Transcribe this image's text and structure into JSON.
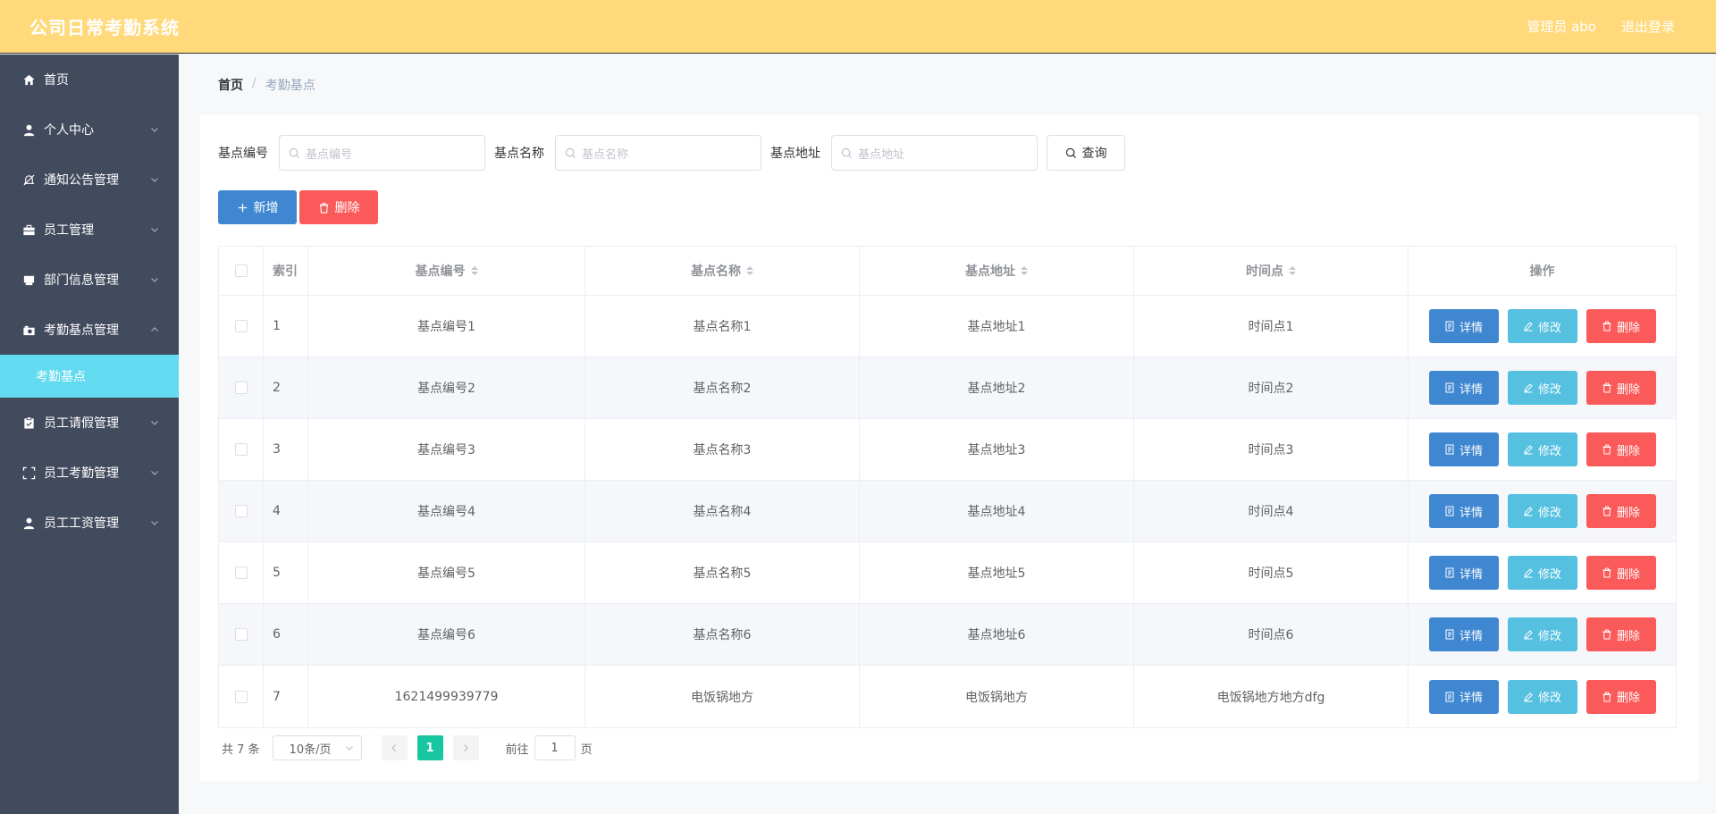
{
  "header": {
    "title": "公司日常考勤系统",
    "user": "管理员 abo",
    "logout": "退出登录"
  },
  "sidebar": {
    "items": [
      {
        "label": "首页",
        "icon": "home-icon"
      },
      {
        "label": "个人中心",
        "icon": "user-icon"
      },
      {
        "label": "通知公告管理",
        "icon": "bell-off-icon"
      },
      {
        "label": "员工管理",
        "icon": "briefcase-icon"
      },
      {
        "label": "部门信息管理",
        "icon": "printer-icon"
      },
      {
        "label": "考勤基点管理",
        "icon": "camera-icon"
      },
      {
        "label": "员工请假管理",
        "icon": "clipboard-icon"
      },
      {
        "label": "员工考勤管理",
        "icon": "frame-icon"
      },
      {
        "label": "员工工资管理",
        "icon": "user-icon"
      }
    ],
    "active_sub": "考勤基点"
  },
  "breadcrumb": {
    "home": "首页",
    "sep": "/",
    "current": "考勤基点"
  },
  "search": {
    "code_label": "基点编号",
    "code_placeholder": "基点编号",
    "name_label": "基点名称",
    "name_placeholder": "基点名称",
    "addr_label": "基点地址",
    "addr_placeholder": "基点地址",
    "query_label": "查询"
  },
  "actions": {
    "add_label": "新增",
    "delete_label": "删除"
  },
  "table": {
    "headers": {
      "index": "索引",
      "code": "基点编号",
      "name": "基点名称",
      "addr": "基点地址",
      "time": "时间点",
      "ops": "操作"
    },
    "op_labels": {
      "detail": "详情",
      "edit": "修改",
      "delete": "删除"
    },
    "rows": [
      {
        "index": "1",
        "code": "基点编号1",
        "name": "基点名称1",
        "addr": "基点地址1",
        "time": "时间点1"
      },
      {
        "index": "2",
        "code": "基点编号2",
        "name": "基点名称2",
        "addr": "基点地址2",
        "time": "时间点2"
      },
      {
        "index": "3",
        "code": "基点编号3",
        "name": "基点名称3",
        "addr": "基点地址3",
        "time": "时间点3"
      },
      {
        "index": "4",
        "code": "基点编号4",
        "name": "基点名称4",
        "addr": "基点地址4",
        "time": "时间点4"
      },
      {
        "index": "5",
        "code": "基点编号5",
        "name": "基点名称5",
        "addr": "基点地址5",
        "time": "时间点5"
      },
      {
        "index": "6",
        "code": "基点编号6",
        "name": "基点名称6",
        "addr": "基点地址6",
        "time": "时间点6"
      },
      {
        "index": "7",
        "code": "1621499939779",
        "name": "电饭锅地方",
        "addr": "电饭锅地方",
        "time": "电饭锅地方地方dfg"
      }
    ]
  },
  "pagination": {
    "total": "共 7 条",
    "page_size": "10条/页",
    "current_page": "1",
    "goto_prefix": "前往",
    "goto_value": "1",
    "goto_suffix": "页"
  }
}
